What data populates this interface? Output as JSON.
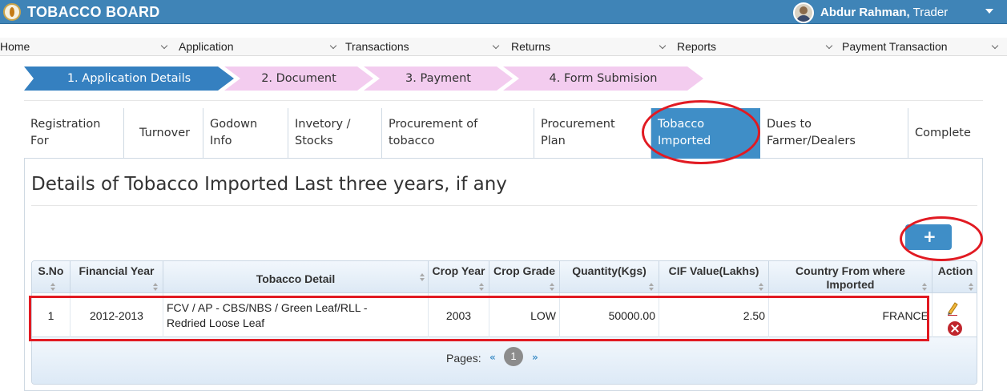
{
  "app": {
    "title": "TOBACCO BOARD",
    "user_name": "Abdur Rahman,",
    "user_role": "Trader"
  },
  "menu": {
    "items": [
      {
        "label": "Home"
      },
      {
        "label": "Application"
      },
      {
        "label": "Transactions"
      },
      {
        "label": "Returns"
      },
      {
        "label": "Reports"
      },
      {
        "label": "Payment Transaction"
      }
    ]
  },
  "wizard": {
    "steps": [
      {
        "label": "1. Application Details",
        "state": "active"
      },
      {
        "label": "2. Document",
        "state": "pending"
      },
      {
        "label": "3. Payment",
        "state": "pending"
      },
      {
        "label": "4. Form Submision",
        "state": "pending"
      }
    ]
  },
  "tabs": {
    "items": [
      {
        "line1": "Registration",
        "line2": "For"
      },
      {
        "line1": "Turnover",
        "line2": ""
      },
      {
        "line1": "Godown",
        "line2": "Info"
      },
      {
        "line1": "Invetory /",
        "line2": "Stocks"
      },
      {
        "line1": "Procurement of",
        "line2": "tobacco"
      },
      {
        "line1": "Procurement",
        "line2": "Plan"
      },
      {
        "line1": "Tobacco",
        "line2": "Imported"
      },
      {
        "line1": "Dues to",
        "line2": "Farmer/Dealers"
      },
      {
        "line1": "Complete",
        "line2": ""
      }
    ],
    "active": "Tobacco Imported"
  },
  "section": {
    "title": "Details of Tobacco Imported Last three years, if any",
    "add_label": "+"
  },
  "table": {
    "headers": [
      {
        "l1": "S.No",
        "l2": ""
      },
      {
        "l1": "Financial Year",
        "l2": ""
      },
      {
        "l1": "Tobacco Detail",
        "l2": ""
      },
      {
        "l1": "Crop Year",
        "l2": ""
      },
      {
        "l1": "Crop Grade",
        "l2": ""
      },
      {
        "l1": "Quantity(Kgs)",
        "l2": ""
      },
      {
        "l1": "CIF Value(Lakhs)",
        "l2": ""
      },
      {
        "l1": "Country From where",
        "l2": "Imported"
      },
      {
        "l1": "Action",
        "l2": ""
      }
    ],
    "rows": [
      {
        "sno": "1",
        "financial_year": "2012-2013",
        "tobacco_detail_1": "FCV / AP - CBS/NBS / Green Leaf/RLL -",
        "tobacco_detail_2": "Redried Loose Leaf",
        "crop_year": "2003",
        "crop_grade": "LOW",
        "quantity": "50000.00",
        "cif_value": "2.50",
        "country": "FRANCE"
      }
    ]
  },
  "pagination": {
    "label": "Pages:",
    "prev": "«",
    "current": "1",
    "next": "»"
  },
  "colors": {
    "header_bg": "#3f84b7",
    "active_tab": "#3f8ec7",
    "wizard_active": "#3580c0",
    "wizard_pending": "#f3ccef",
    "highlight": "#e11a22"
  }
}
